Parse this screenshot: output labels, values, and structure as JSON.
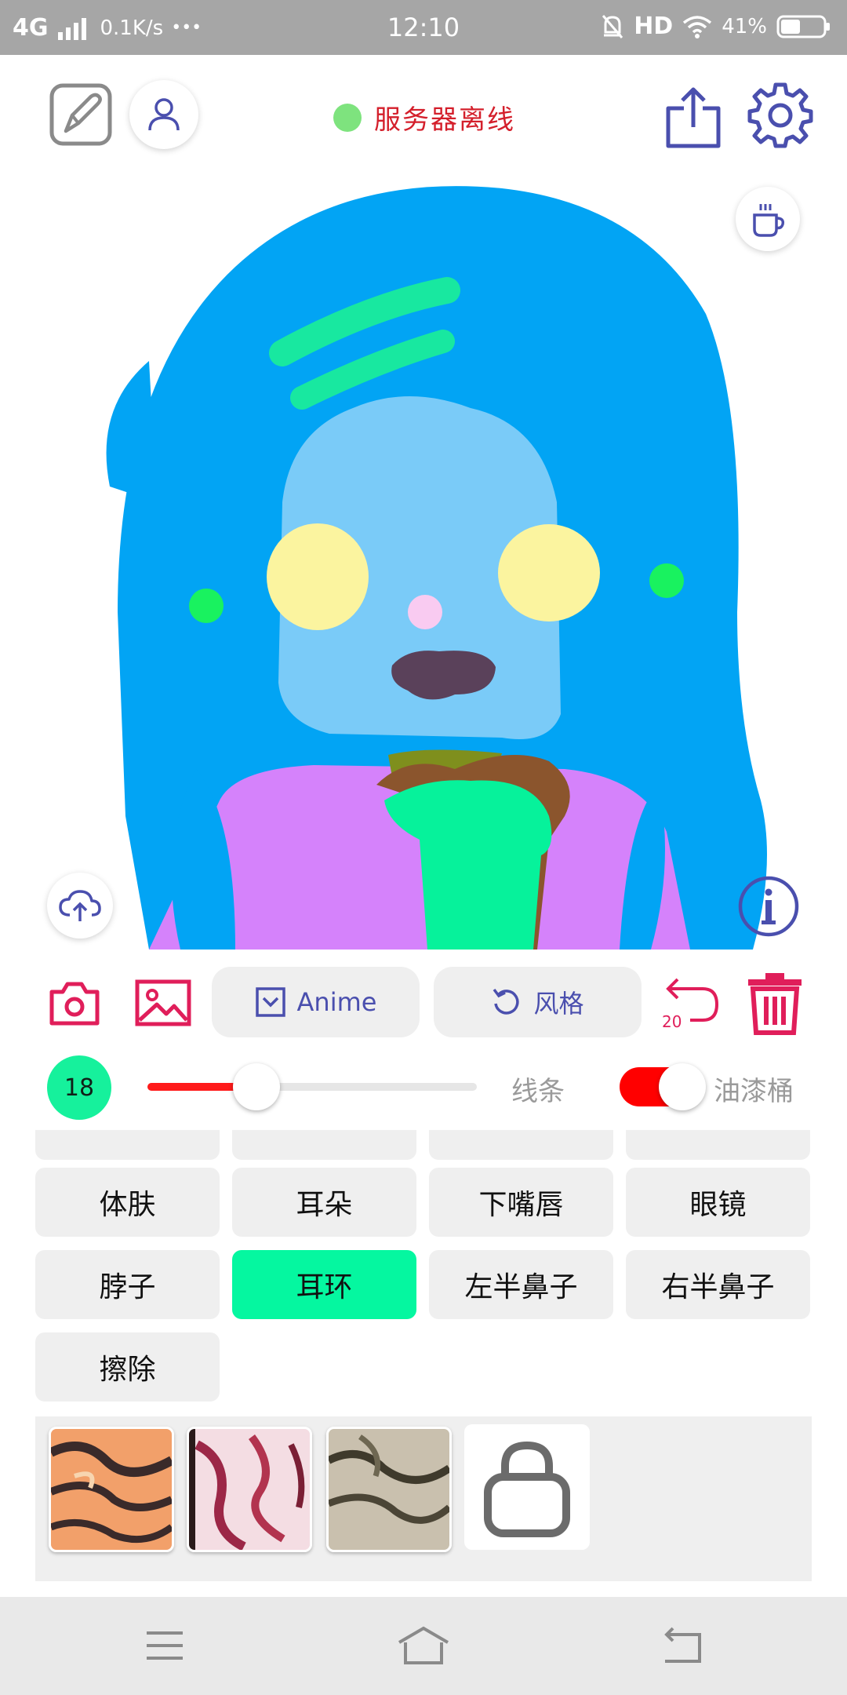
{
  "status_bar": {
    "network": "4G",
    "speed": "0.1K/s",
    "more": "•••",
    "time": "12:10",
    "hd": "HD",
    "battery": "41%"
  },
  "header": {
    "server_status": "服务器离线",
    "server_status_color": "#7ee37e"
  },
  "toolbar": {
    "style_model": "Anime",
    "style_button": "风格",
    "undo_count": "20"
  },
  "brush": {
    "size": "18",
    "line_label": "线条",
    "bucket_label": "油漆桶",
    "slider_level": 0.33,
    "bucket_enabled": true
  },
  "parts": {
    "row1": [
      "体肤",
      "耳朵",
      "下嘴唇",
      "眼镜"
    ],
    "row2": [
      "脖子",
      "耳环",
      "左半鼻子",
      "右半鼻子"
    ],
    "row3": [
      "擦除"
    ],
    "active": "耳环"
  },
  "textures": {
    "items": [
      "orange-tiger-texture",
      "pink-red-texture",
      "grey-olive-texture"
    ],
    "locked": "lock-icon"
  },
  "colors": {
    "hair": "#02a4f4",
    "skin": "#7acbf8",
    "shirt": "#d582fb",
    "accent": "#05f7a0",
    "danger": "#e01e5a",
    "icon_purple": "#4a4fae"
  }
}
